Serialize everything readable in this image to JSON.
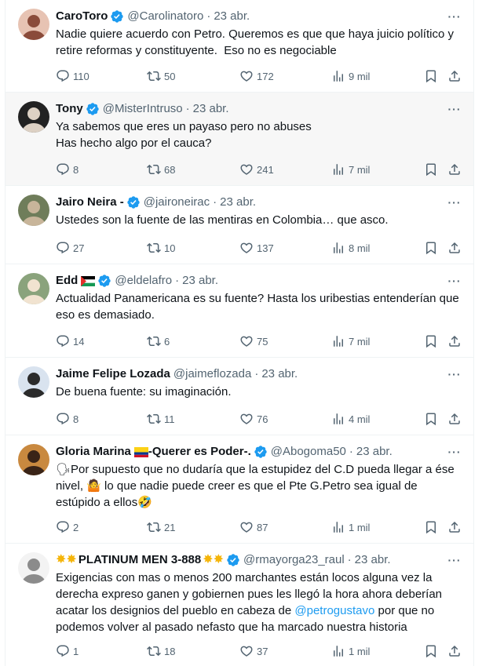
{
  "tweets": [
    {
      "name": "CaroToro",
      "handle": "@Carolinatoro",
      "time": "23 abr.",
      "verified": true,
      "text": "Nadie quiere acuerdo con Petro. Queremos es que que haya juicio político y retire reformas y constituyente.  Eso no es negociable",
      "replies": "110",
      "retweets": "50",
      "likes": "172",
      "views": "9 mil"
    },
    {
      "name": "Tony",
      "handle": "@MisterIntruso",
      "time": "23 abr.",
      "verified": true,
      "text": "Ya sabemos que eres un payaso pero no abuses\nHas hecho algo por el cauca?",
      "replies": "8",
      "retweets": "68",
      "likes": "241",
      "views": "7 mil"
    },
    {
      "name": "Jairo Neira -",
      "handle": "@jaironeirac",
      "time": "23 abr.",
      "verified": true,
      "text": "Ustedes son la fuente de las mentiras en Colombia… que asco.",
      "replies": "27",
      "retweets": "10",
      "likes": "137",
      "views": "8 mil"
    },
    {
      "name": "Edd",
      "handle": "@eldelafro",
      "time": "23 abr.",
      "verified": true,
      "text": "Actualidad Panamericana es su fuente? Hasta los uribestias entenderían que eso es demasiado.",
      "replies": "14",
      "retweets": "6",
      "likes": "75",
      "views": "7 mil"
    },
    {
      "name": "Jaime Felipe Lozada",
      "handle": "@jaimeflozada",
      "time": "23 abr.",
      "verified": false,
      "text": "De buena fuente: su imaginación.",
      "replies": "8",
      "retweets": "11",
      "likes": "76",
      "views": "4 mil"
    },
    {
      "name": "Gloria Marina",
      "name_suffix": "-Querer es Poder-.",
      "handle": "@Abogoma50",
      "time": "23 abr.",
      "verified": true,
      "text_parts": [
        "Por supuesto que no dudaría que la estupidez del C.D pueda llegar a ése nivel, ",
        " lo que nadie puede creer es que el Pte G.Petro sea igual de estúpido a ellos"
      ],
      "replies": "2",
      "retweets": "21",
      "likes": "87",
      "views": "1 mil"
    },
    {
      "name": "PLATINUM MEN 3-888",
      "handle": "@rmayorga23_raul",
      "time": "23 abr.",
      "verified": true,
      "text_before": "Exigencias con mas o menos 200 marchantes están locos alguna vez la derecha expreso ganen y gobiernen pues les llegó la hora ahora deberían acatar los designios del pueblo en cabeza de ",
      "mention": "@petrogustavo",
      "text_after": " por que no podemos volver al pasado nefasto que ha marcado nuestra historia",
      "replies": "1",
      "retweets": "18",
      "likes": "37",
      "views": "1 mil"
    }
  ],
  "separator": "·",
  "more_icon": "···",
  "colors": {
    "accent": "#1d9bf0",
    "secondary": "#536471",
    "text": "#0f1419"
  }
}
